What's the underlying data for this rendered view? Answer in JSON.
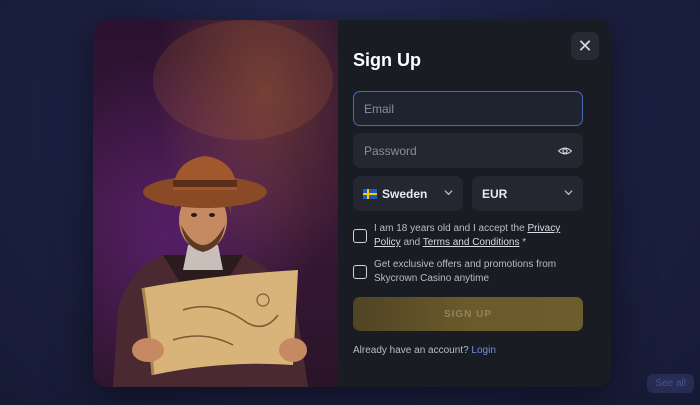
{
  "backdrop": {
    "see_all_label": "See all"
  },
  "modal": {
    "title": "Sign Up",
    "close_label": "✕",
    "email": {
      "placeholder": "Email",
      "value": ""
    },
    "password": {
      "placeholder": "Password",
      "value": ""
    },
    "country": {
      "selected": "Sweden",
      "flag": "sweden-flag"
    },
    "currency": {
      "selected": "EUR"
    },
    "age_consent": {
      "prefix": "I am 18 years old and I accept the ",
      "privacy_link": "Privacy Policy",
      "middle": " and ",
      "terms_link": "Terms and Conditions",
      "suffix": " *"
    },
    "offers_consent": {
      "text": "Get exclusive offers and promotions from Skycrown Casino anytime"
    },
    "signup_button": "SIGN UP",
    "login_prompt": "Already have an account?",
    "login_link": "Login"
  },
  "colors": {
    "accent_blue": "#4a68b8",
    "link_blue": "#6f8ee8",
    "button_gold": "#6b5a2a",
    "modal_bg": "#1a1c24"
  }
}
